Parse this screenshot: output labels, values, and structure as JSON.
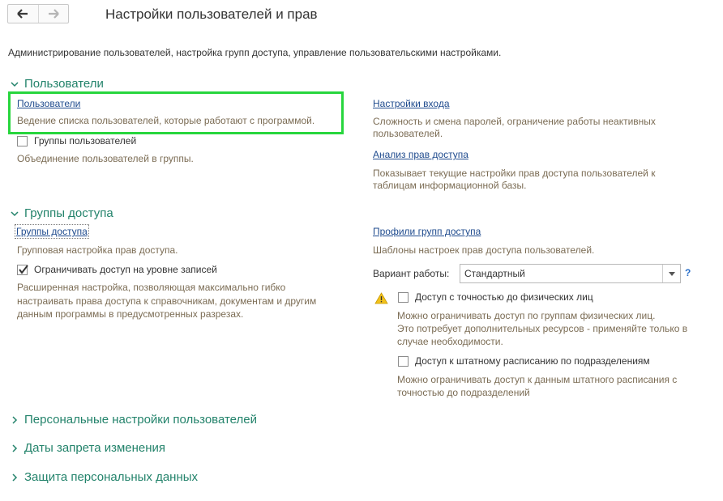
{
  "header": {
    "back_icon": "arrow-left-icon",
    "forward_icon": "arrow-right-icon",
    "title": "Настройки пользователей и прав",
    "subtitle": "Администрирование пользователей, настройка групп доступа, управление пользовательскими настройками."
  },
  "users_group": {
    "title": "Пользователи",
    "users_link": "Пользователи",
    "users_hint": "Ведение списка пользователей, которые работают с программой.",
    "user_groups_label": "Группы пользователей",
    "user_groups_checked": false,
    "user_groups_hint": "Объединение пользователей в группы.",
    "login_settings_link": "Настройки входа",
    "login_settings_hint_1": "Сложность и смена паролей, ограничение работы неактивных",
    "login_settings_hint_2": "пользователей.",
    "access_analysis_link": "Анализ прав доступа",
    "access_analysis_hint_1": "Показывает текущие настройки прав доступа пользователей к",
    "access_analysis_hint_2": "таблицам информационной базы."
  },
  "access_group": {
    "title": "Группы доступа",
    "access_groups_link": "Группы доступа",
    "access_groups_hint": "Групповая настройка прав доступа.",
    "record_level_label": "Ограничивать доступ на уровне записей",
    "record_level_checked": true,
    "record_level_hint_1": "Расширенная настройка, позволяющая максимально гибко",
    "record_level_hint_2": "настраивать права доступа к справочникам, документам и другим",
    "record_level_hint_3": "данным программы в предусмотренных разрезах.",
    "profiles_link": "Профили групп доступа",
    "profiles_hint": "Шаблоны настроек прав доступа пользователей.",
    "work_mode_label": "Вариант работы:",
    "work_mode_value": "Стандартный",
    "help_label": "?",
    "warning_icon": "warning-icon",
    "individuals_label": "Доступ с точностью до физических лиц",
    "individuals_checked": false,
    "individuals_hint_1": "Можно ограничивать доступ по группам физических лиц.",
    "individuals_hint_2": "Это потребует дополнительных ресурсов - применяйте только в",
    "individuals_hint_3": "случае необходимости.",
    "staffing_label": "Доступ к штатному расписанию по подразделениям",
    "staffing_checked": false,
    "staffing_hint_1": "Можно ограничивать доступ к данным штатного расписания с",
    "staffing_hint_2": "точностью до подразделений"
  },
  "collapsed_groups": [
    {
      "title": "Персональные настройки пользователей"
    },
    {
      "title": "Даты запрета изменения"
    },
    {
      "title": "Защита персональных данных"
    }
  ],
  "colors": {
    "group_title": "#23836b",
    "link": "#1f4b8e",
    "hint": "#7b6c54",
    "highlight": "#27d63d"
  }
}
